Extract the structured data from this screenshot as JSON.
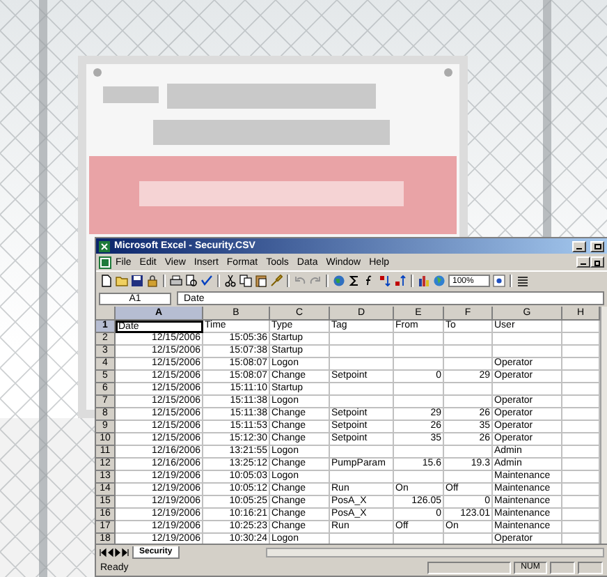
{
  "window": {
    "title": "Microsoft Excel - Security.CSV"
  },
  "menu": [
    "File",
    "Edit",
    "View",
    "Insert",
    "Format",
    "Tools",
    "Data",
    "Window",
    "Help"
  ],
  "toolbar": {
    "zoom": "100%"
  },
  "formula_bar": {
    "name_box": "A1",
    "formula": "Date"
  },
  "columns": [
    {
      "label": "A",
      "selected": true
    },
    {
      "label": "B",
      "selected": false
    },
    {
      "label": "C",
      "selected": false
    },
    {
      "label": "D",
      "selected": false
    },
    {
      "label": "E",
      "selected": false
    },
    {
      "label": "F",
      "selected": false
    },
    {
      "label": "G",
      "selected": false
    },
    {
      "label": "H",
      "selected": false
    }
  ],
  "rows": [
    {
      "number": "1",
      "selected": true,
      "cells": [
        "Date",
        "Time",
        "Type",
        "Tag",
        "From",
        "To",
        "User",
        null
      ]
    },
    {
      "number": "2",
      "selected": false,
      "cells": [
        {
          "number": "12/15/2006"
        },
        {
          "number": "15:05:36"
        },
        "Startup",
        null,
        null,
        null,
        null,
        null
      ]
    },
    {
      "number": "3",
      "selected": false,
      "cells": [
        {
          "number": "12/15/2006"
        },
        {
          "number": "15:07:38"
        },
        "Startup",
        null,
        null,
        null,
        null,
        null
      ]
    },
    {
      "number": "4",
      "selected": false,
      "cells": [
        {
          "number": "12/15/2006"
        },
        {
          "number": "15:08:07"
        },
        "Logon",
        null,
        null,
        null,
        "Operator",
        null
      ]
    },
    {
      "number": "5",
      "selected": false,
      "cells": [
        {
          "number": "12/15/2006"
        },
        {
          "number": "15:08:07"
        },
        "Change",
        "Setpoint",
        {
          "number": "0"
        },
        {
          "number": "29"
        },
        "Operator",
        null
      ]
    },
    {
      "number": "6",
      "selected": false,
      "cells": [
        {
          "number": "12/15/2006"
        },
        {
          "number": "15:11:10"
        },
        "Startup",
        null,
        null,
        null,
        null,
        null
      ]
    },
    {
      "number": "7",
      "selected": false,
      "cells": [
        {
          "number": "12/15/2006"
        },
        {
          "number": "15:11:38"
        },
        "Logon",
        null,
        null,
        null,
        "Operator",
        null
      ]
    },
    {
      "number": "8",
      "selected": false,
      "cells": [
        {
          "number": "12/15/2006"
        },
        {
          "number": "15:11:38"
        },
        "Change",
        "Setpoint",
        {
          "number": "29"
        },
        {
          "number": "26"
        },
        "Operator",
        null
      ]
    },
    {
      "number": "9",
      "selected": false,
      "cells": [
        {
          "number": "12/15/2006"
        },
        {
          "number": "15:11:53"
        },
        "Change",
        "Setpoint",
        {
          "number": "26"
        },
        {
          "number": "35"
        },
        "Operator",
        null
      ]
    },
    {
      "number": "10",
      "selected": false,
      "cells": [
        {
          "number": "12/15/2006"
        },
        {
          "number": "15:12:30"
        },
        "Change",
        "Setpoint",
        {
          "number": "35"
        },
        {
          "number": "26"
        },
        "Operator",
        null
      ]
    },
    {
      "number": "11",
      "selected": false,
      "cells": [
        {
          "number": "12/16/2006"
        },
        {
          "number": "13:21:55"
        },
        "Logon",
        null,
        null,
        null,
        "Admin",
        null
      ]
    },
    {
      "number": "12",
      "selected": false,
      "cells": [
        {
          "number": "12/16/2006"
        },
        {
          "number": "13:25:12"
        },
        "Change",
        "PumpParam",
        {
          "number": "15.6"
        },
        {
          "number": "19.3"
        },
        "Admin",
        null
      ]
    },
    {
      "number": "13",
      "selected": false,
      "cells": [
        {
          "number": "12/19/2006"
        },
        {
          "number": "10:05:03"
        },
        "Logon",
        null,
        null,
        null,
        "Maintenance",
        null
      ]
    },
    {
      "number": "14",
      "selected": false,
      "cells": [
        {
          "number": "12/19/2006"
        },
        {
          "number": "10:05:12"
        },
        "Change",
        "Run",
        "On",
        "Off",
        "Maintenance",
        null
      ]
    },
    {
      "number": "15",
      "selected": false,
      "cells": [
        {
          "number": "12/19/2006"
        },
        {
          "number": "10:05:25"
        },
        "Change",
        "PosA_X",
        {
          "number": "126.05"
        },
        {
          "number": "0"
        },
        "Maintenance",
        null
      ]
    },
    {
      "number": "16",
      "selected": false,
      "cells": [
        {
          "number": "12/19/2006"
        },
        {
          "number": "10:16:21"
        },
        "Change",
        "PosA_X",
        {
          "number": "0"
        },
        {
          "number": "123.01"
        },
        "Maintenance",
        null
      ]
    },
    {
      "number": "17",
      "selected": false,
      "cells": [
        {
          "number": "12/19/2006"
        },
        {
          "number": "10:25:23"
        },
        "Change",
        "Run",
        "Off",
        "On",
        "Maintenance",
        null
      ]
    },
    {
      "number": "18",
      "selected": false,
      "cells": [
        {
          "number": "12/19/2006"
        },
        {
          "number": "10:30:24"
        },
        "Logon",
        null,
        null,
        null,
        "Operator",
        null
      ]
    }
  ],
  "sheet_tabs": [
    {
      "label": "Security",
      "selected": true
    }
  ],
  "status_bar": {
    "message": "Ready",
    "indicator": "NUM"
  }
}
